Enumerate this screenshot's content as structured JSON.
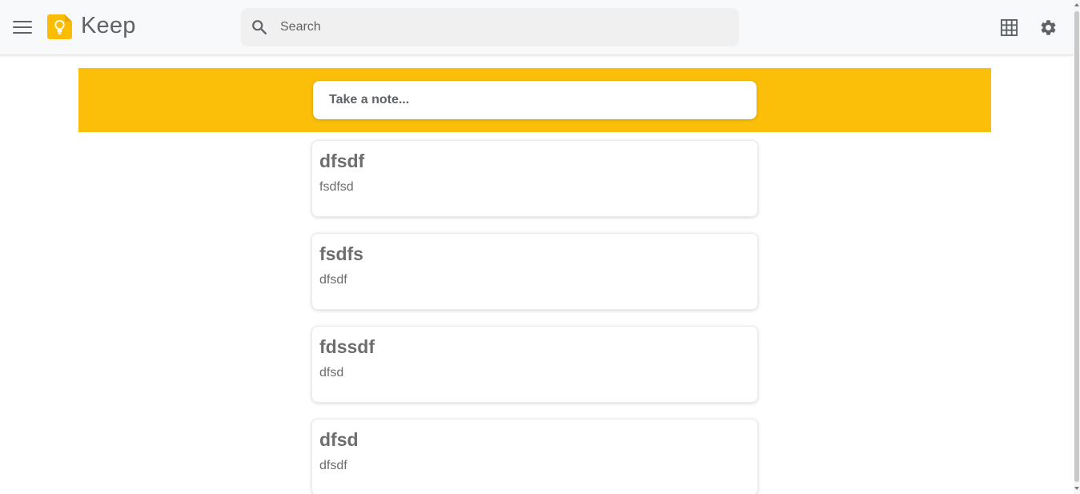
{
  "app": {
    "title": "Keep"
  },
  "header": {
    "menu_icon": "menu-icon",
    "logo_icon": "keep-lightbulb-icon",
    "search": {
      "placeholder": "Search",
      "value": ""
    },
    "layout_icon": "grid-view-icon",
    "settings_icon": "settings-gear-icon"
  },
  "banner": {
    "color": "#fbbf09",
    "note_input": {
      "placeholder": "Take a note...",
      "value": ""
    }
  },
  "notes": [
    {
      "title": "dfsdf",
      "body": "fsdfsd"
    },
    {
      "title": "fsdfs",
      "body": "dfsdf"
    },
    {
      "title": "fdssdf",
      "body": "dfsd"
    },
    {
      "title": "dfsd",
      "body": "dfsdf"
    }
  ],
  "colors": {
    "header_bg": "#f8f9fa",
    "search_bg": "#f1f0f0",
    "icon_gray": "#5f6368",
    "logo_yellow": "#fbbc04"
  }
}
